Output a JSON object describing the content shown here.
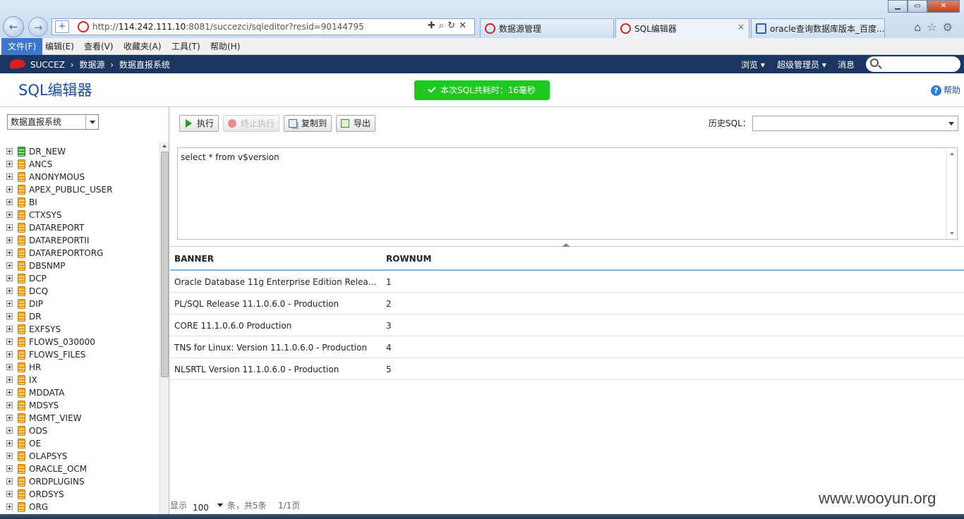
{
  "browser": {
    "url_prefix": "http://",
    "url_host": "114.242.111.10",
    "url_rest": ":8081/succezci/sqleditor?resid=90144795",
    "tabs": [
      {
        "label": "数据源管理"
      },
      {
        "label": "SQL编辑器",
        "close": "×"
      },
      {
        "label": "oracle查询数据库版本_百度..."
      }
    ]
  },
  "menu": [
    "文件(F)",
    "编辑(E)",
    "查看(V)",
    "收藏夹(A)",
    "工具(T)",
    "帮助(H)"
  ],
  "app": {
    "breadcrumb": [
      "SUCCEZ",
      "›",
      "数据源",
      "›",
      "数据直报系统"
    ],
    "nav": {
      "browse": "浏览 ▾",
      "admin": "超级管理员 ▾",
      "messages": "消息"
    }
  },
  "page": {
    "title": "SQL编辑器",
    "toast": "本次SQL共耗时：16毫秒",
    "help": "帮助"
  },
  "datasource": {
    "selected": "数据直报系统",
    "tree": [
      "DR_NEW",
      "ANCS",
      "ANONYMOUS",
      "APEX_PUBLIC_USER",
      "BI",
      "CTXSYS",
      "DATAREPORT",
      "DATAREPORTII",
      "DATAREPORTORG",
      "DBSNMP",
      "DCP",
      "DCQ",
      "DIP",
      "DR",
      "EXFSYS",
      "FLOWS_030000",
      "FLOWS_FILES",
      "HR",
      "IX",
      "MDDATA",
      "MDSYS",
      "MGMT_VIEW",
      "ODS",
      "OE",
      "OLAPSYS",
      "ORACLE_OCM",
      "ORDPLUGINS",
      "ORDSYS",
      "ORG"
    ]
  },
  "toolbar": {
    "execute": "执行",
    "stop": "终止执行",
    "copy_to": "复制到",
    "export": "导出",
    "history_label": "历史SQL："
  },
  "editor": {
    "sql": "select * from v$version"
  },
  "results": {
    "columns": [
      "BANNER",
      "ROWNUM"
    ],
    "rows": [
      [
        "Oracle Database 11g Enterprise Edition Release...",
        "1"
      ],
      [
        "PL/SQL Release 11.1.0.6.0 - Production",
        "2"
      ],
      [
        "CORE 11.1.0.6.0 Production",
        "3"
      ],
      [
        "TNS for Linux: Version 11.1.0.6.0 - Production",
        "4"
      ],
      [
        "NLSRTL Version 11.1.0.6.0 - Production",
        "5"
      ]
    ]
  },
  "pager": {
    "show": "显示",
    "page_size": "100",
    "unit_total": "条，共5条",
    "page": "1/1页"
  },
  "watermark": "www.wooyun.org",
  "colors": {
    "accent": "#1a4f9c",
    "header": "#1b3660",
    "success": "#1fc81f"
  }
}
